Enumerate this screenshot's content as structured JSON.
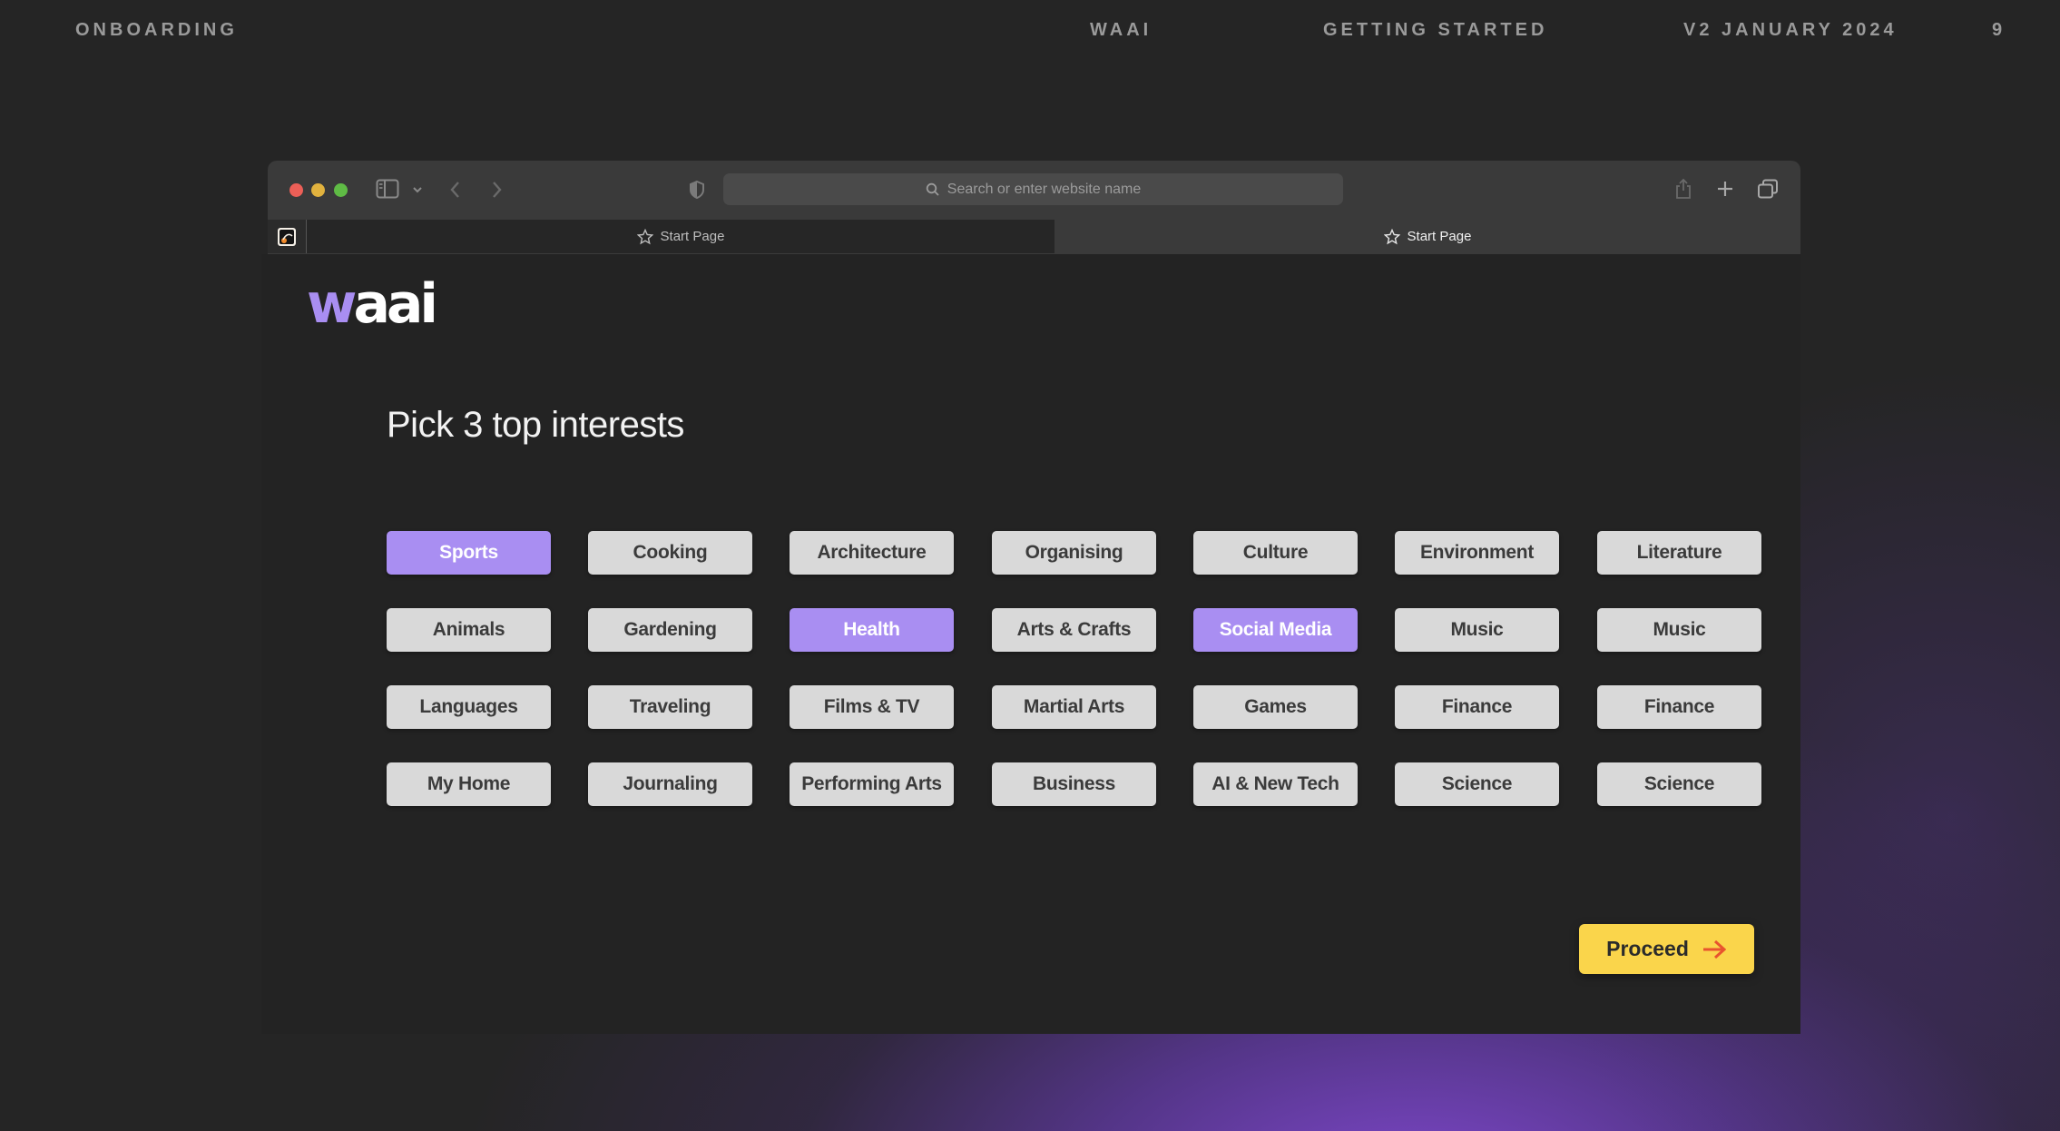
{
  "slide_header": {
    "section": "ONBOARDING",
    "brand": "WAAI",
    "chapter": "GETTING STARTED",
    "version": "V2 JANUARY 2024",
    "page_number": "9"
  },
  "browser": {
    "search_placeholder": "Search or enter website name",
    "tabs": [
      {
        "label": "Start Page",
        "active": false
      },
      {
        "label": "Start Page",
        "active": true
      }
    ]
  },
  "app": {
    "logo_text_accent": "w",
    "logo_text": "aai",
    "heading": "Pick 3 top interests",
    "interests": [
      {
        "label": "Sports",
        "selected": true
      },
      {
        "label": "Cooking",
        "selected": false
      },
      {
        "label": "Architecture",
        "selected": false
      },
      {
        "label": "Organising",
        "selected": false
      },
      {
        "label": "Culture",
        "selected": false
      },
      {
        "label": "Environment",
        "selected": false
      },
      {
        "label": "Literature",
        "selected": false
      },
      {
        "label": "Animals",
        "selected": false
      },
      {
        "label": "Gardening",
        "selected": false
      },
      {
        "label": "Health",
        "selected": true
      },
      {
        "label": "Arts & Crafts",
        "selected": false
      },
      {
        "label": "Social Media",
        "selected": true
      },
      {
        "label": "Music",
        "selected": false
      },
      {
        "label": "Music",
        "selected": false
      },
      {
        "label": "Languages",
        "selected": false
      },
      {
        "label": "Traveling",
        "selected": false
      },
      {
        "label": "Films & TV",
        "selected": false
      },
      {
        "label": "Martial Arts",
        "selected": false
      },
      {
        "label": "Games",
        "selected": false
      },
      {
        "label": "Finance",
        "selected": false
      },
      {
        "label": "Finance",
        "selected": false
      },
      {
        "label": "My Home",
        "selected": false
      },
      {
        "label": "Journaling",
        "selected": false
      },
      {
        "label": "Performing Arts",
        "selected": false
      },
      {
        "label": "Business",
        "selected": false
      },
      {
        "label": "AI & New Tech",
        "selected": false
      },
      {
        "label": "Science",
        "selected": false
      },
      {
        "label": "Science",
        "selected": false
      }
    ],
    "proceed_label": "Proceed"
  },
  "colors": {
    "selected_pill": "#a98ef2",
    "pill": "#d9d9d9",
    "proceed": "#fad54b",
    "logo_accent": "#a98ef2"
  }
}
